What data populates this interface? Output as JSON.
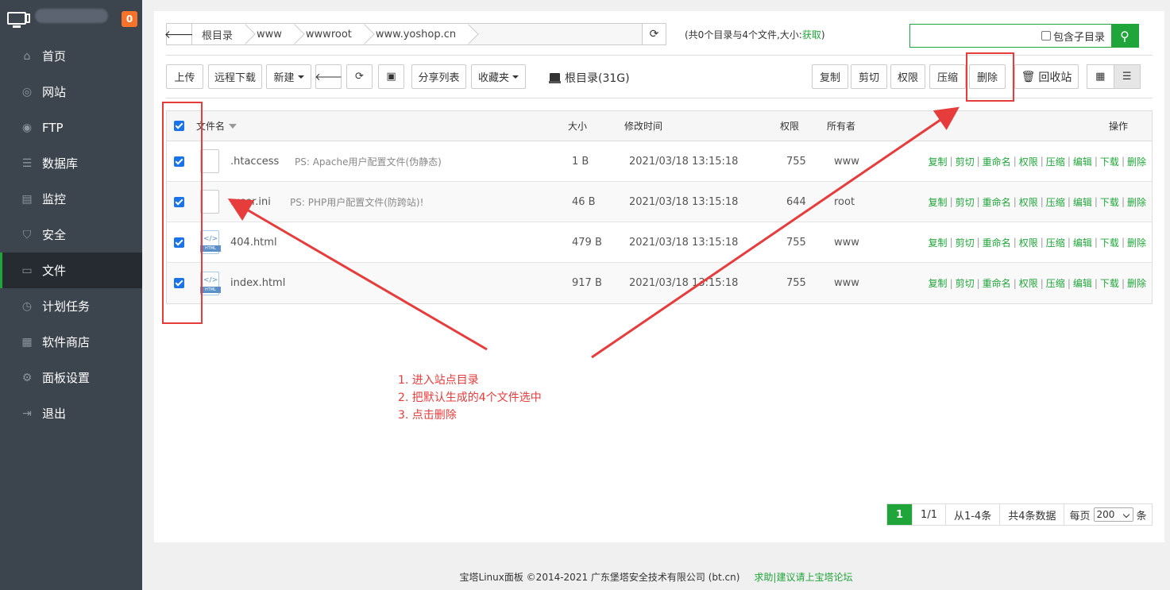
{
  "brand": {
    "badge": "0"
  },
  "sidebar": {
    "items": [
      {
        "label": "首页",
        "icon": "home-icon",
        "glyph": "⌂"
      },
      {
        "label": "网站",
        "icon": "globe-icon",
        "glyph": "◎"
      },
      {
        "label": "FTP",
        "icon": "ftp-icon",
        "glyph": "◉"
      },
      {
        "label": "数据库",
        "icon": "database-icon",
        "glyph": "☰"
      },
      {
        "label": "监控",
        "icon": "monitor-icon",
        "glyph": "▤"
      },
      {
        "label": "安全",
        "icon": "shield-icon",
        "glyph": "⛉"
      },
      {
        "label": "文件",
        "icon": "folder-icon",
        "glyph": "▭"
      },
      {
        "label": "计划任务",
        "icon": "clock-icon",
        "glyph": "◷"
      },
      {
        "label": "软件商店",
        "icon": "apps-icon",
        "glyph": "▦"
      },
      {
        "label": "面板设置",
        "icon": "gear-icon",
        "glyph": "⚙"
      },
      {
        "label": "退出",
        "icon": "logout-icon",
        "glyph": "⇥"
      }
    ],
    "active_index": 6
  },
  "path": {
    "crumbs": [
      "根目录",
      "www",
      "wwwroot",
      "www.yoshop.cn"
    ]
  },
  "count": {
    "text": "(共0个目录与4个文件,大小:",
    "link": "获取",
    "close": ")"
  },
  "search": {
    "placeholder": "",
    "include_sub": "包含子目录"
  },
  "toolbar": {
    "upload": "上传",
    "remote_download": "远程下载",
    "new": "新建",
    "share_list": "分享列表",
    "favorites": "收藏夹",
    "root_disk": "根目录(31G)",
    "copy": "复制",
    "cut": "剪切",
    "permission": "权限",
    "compress": "压缩",
    "delete": "删除",
    "recycle": "回收站"
  },
  "table": {
    "headers": {
      "name": "文件名",
      "size": "大小",
      "mtime": "修改时间",
      "perm": "权限",
      "owner": "所有者",
      "ops": "操作"
    },
    "rows": [
      {
        "name": ".htaccess",
        "ps": "PS: Apache用户配置文件(伪静态)",
        "size": "1 B",
        "mtime": "2021/03/18 13:15:18",
        "perm": "755",
        "owner": "www",
        "type": "file"
      },
      {
        "name": ".user.ini",
        "ps": "PS: PHP用户配置文件(防跨站)!",
        "size": "46 B",
        "mtime": "2021/03/18 13:15:18",
        "perm": "644",
        "owner": "root",
        "type": "file"
      },
      {
        "name": "404.html",
        "ps": "",
        "size": "479 B",
        "mtime": "2021/03/18 13:15:18",
        "perm": "755",
        "owner": "www",
        "type": "html"
      },
      {
        "name": "index.html",
        "ps": "",
        "size": "917 B",
        "mtime": "2021/03/18 13:15:18",
        "perm": "755",
        "owner": "www",
        "type": "html"
      }
    ],
    "row_ops": [
      "复制",
      "剪切",
      "重命名",
      "权限",
      "压缩",
      "编辑",
      "下载",
      "删除"
    ],
    "html_tag": "HTML",
    "html_code": "</>"
  },
  "pager": {
    "current": "1",
    "pages": "1/1",
    "range": "从1-4条",
    "total": "共4条数据",
    "per_label": "每页",
    "per_value": "200",
    "per_unit": "条"
  },
  "annotation": {
    "lines": [
      "1. 进入站点目录",
      "2. 把默认生成的4个文件选中",
      "3. 点击删除"
    ],
    "color": "#e63c3c"
  },
  "footer": {
    "copyright": "宝塔Linux面板 ©2014-2021 广东堡塔安全技术有限公司 (bt.cn)",
    "link": "求助|建议请上宝塔论坛"
  },
  "colors": {
    "accent": "#20a53a",
    "sidebar": "#3c444d",
    "badge": "#f7722a"
  }
}
